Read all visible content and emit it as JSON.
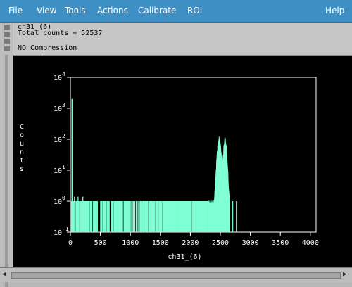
{
  "menubar": {
    "file": "File",
    "view": "View",
    "tools": "Tools",
    "actions": "Actions",
    "calibrate": "Calibrate",
    "roi": "ROI",
    "help": "Help"
  },
  "info": {
    "spectrum_name": "ch31_(6)",
    "total_counts": "Total counts = 52537",
    "compression": "NO Compression"
  },
  "chart_data": {
    "type": "bar",
    "xlabel": "ch31_(6)",
    "ylabel": "Counts",
    "xlim": [
      0,
      4096
    ],
    "ylim": [
      0.1,
      10000
    ],
    "yscale": "log",
    "grid": false,
    "x_ticks": [
      "0",
      "500",
      "1000",
      "1500",
      "2000",
      "2500",
      "3000",
      "3500",
      "4000"
    ],
    "y_ticks": [
      {
        "base": "10",
        "exp": "-1"
      },
      {
        "base": "10",
        "exp": "0"
      },
      {
        "base": "10",
        "exp": "1"
      },
      {
        "base": "10",
        "exp": "2"
      },
      {
        "base": "10",
        "exp": "3"
      },
      {
        "base": "10",
        "exp": "4"
      }
    ],
    "color": "#7fffd4",
    "peaks": [
      {
        "x": 30,
        "y": 2000
      },
      {
        "x": 2480,
        "y": 100
      },
      {
        "x": 2580,
        "y": 100
      }
    ]
  }
}
